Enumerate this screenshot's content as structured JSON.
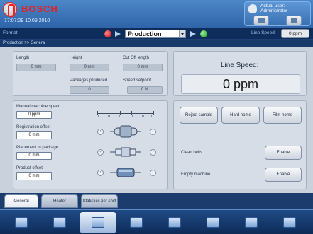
{
  "header": {
    "brand": "BOSCH",
    "datetime": "17:07:29 10.09.2010",
    "user_line1": "Actual user:",
    "user_line2": "Administrator"
  },
  "formatbar": {
    "format_label": "Format",
    "selected_format": "Production",
    "line_speed_label": "Line Speed:",
    "line_speed_value": "0 ppm"
  },
  "breadcrumb": "Production >> General",
  "readouts": {
    "length_label": "Length",
    "length_value": "0 mm",
    "height_label": "Height",
    "height_value": "0 mm",
    "cutoff_label": "Cut Off length",
    "cutoff_value": "0 mm",
    "packages_label": "Packages produced",
    "packages_value": "0",
    "speed_setpoint_label": "Speed setpoint",
    "speed_setpoint_value": "0 %"
  },
  "line_speed": {
    "title": "Line Speed:",
    "value": "0 ppm"
  },
  "adjust": {
    "manual_speed_label": "Manual machine speed",
    "manual_speed_value": "0 ppm",
    "registration_label": "Registration offset",
    "registration_value": "0 mm",
    "placement_label": "Placement in package",
    "placement_value": "0 mm",
    "product_offset_label": "Product offset",
    "product_offset_value": "0 mm",
    "slider_ticks": [
      "0",
      "0",
      "0",
      "0",
      "0",
      "0"
    ]
  },
  "actions": {
    "reject_sample": "Reject sample",
    "hard_home": "Hard home",
    "film_home": "Film home",
    "clean_belts_label": "Clean belts",
    "clean_belts_button": "Enable",
    "empty_machine_label": "Empty machine",
    "empty_machine_button": "Enable"
  },
  "tabs": [
    "General",
    "Heater",
    "Statistics per shift"
  ],
  "bottom_nav": [
    "nav-overview",
    "nav-format",
    "nav-production",
    "nav-diagnostics",
    "nav-tools",
    "nav-network",
    "nav-documents",
    "nav-user"
  ],
  "colors": {
    "brand_red": "#e81f1f",
    "status_red": "#d40000",
    "status_green": "#159a15",
    "accent_blue": "#2f64a8"
  }
}
